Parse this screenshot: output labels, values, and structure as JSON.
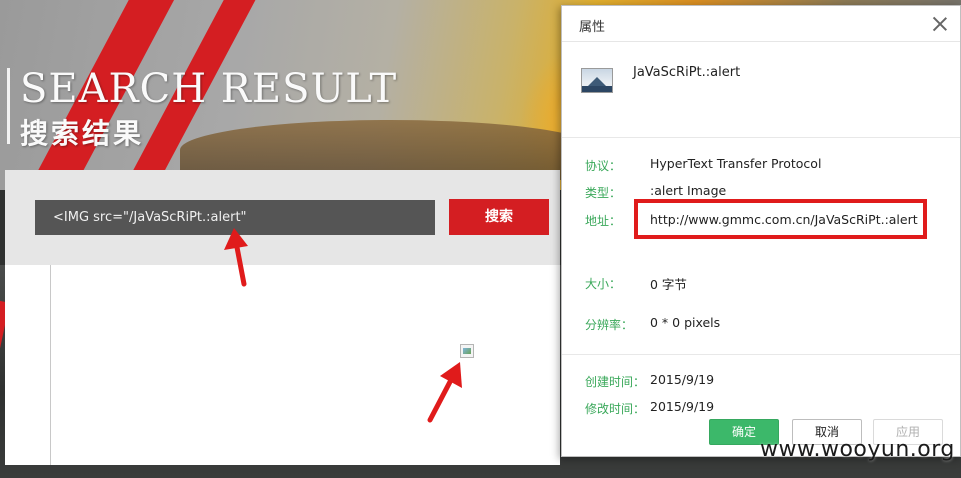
{
  "page": {
    "title_en": "SEARCH RESULT",
    "title_cn": "搜索结果",
    "search_value": "<IMG src=\"/JaVaScRiPt.:alert\"",
    "search_button": "搜索"
  },
  "dialog": {
    "title": "属性",
    "file_name": "JaVaScRiPt.:alert",
    "properties": [
      {
        "label": "协议：",
        "value": "HyperText Transfer Protocol"
      },
      {
        "label": "类型：",
        "value": ":alert Image"
      },
      {
        "label": "地址：",
        "value": "http://www.gmmc.com.cn/JaVaScRiPt.:alert"
      },
      {
        "label": "大小：",
        "value": "0 字节"
      },
      {
        "label": "分辨率：",
        "value": "0 * 0 pixels"
      },
      {
        "label": "创建时间：",
        "value": "2015/9/19"
      },
      {
        "label": "修改时间：",
        "value": "2015/9/19"
      }
    ],
    "buttons": {
      "ok": "确定",
      "cancel": "取消",
      "apply": "应用"
    }
  },
  "watermark": "www.wooyun.org",
  "colors": {
    "accent_red": "#d41e22",
    "highlight_red": "#e01b1b",
    "label_green": "#3aa85a",
    "ok_green": "#3cb86a"
  }
}
